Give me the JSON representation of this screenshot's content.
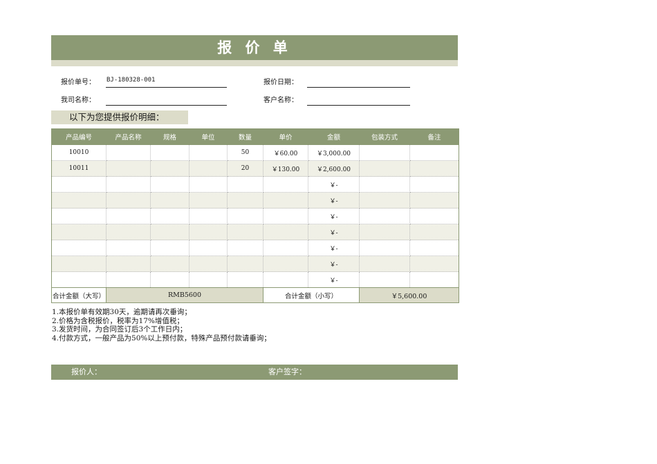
{
  "title": "报 价 单",
  "info": {
    "quote_no_label": "报价单号：",
    "quote_no_value": "BJ-180328-001",
    "quote_date_label": "报价日期：",
    "quote_date_value": "",
    "company_label": "我司名称：",
    "company_value": "",
    "customer_label": "客户名称：",
    "customer_value": ""
  },
  "detail_heading": "以下为您提供报价明细：",
  "table": {
    "headers": [
      "产品编号",
      "产品名称",
      "规格",
      "单位",
      "数量",
      "单价",
      "金额",
      "包装方式",
      "备注"
    ],
    "rows": [
      [
        "10010",
        "",
        "",
        "",
        "50",
        "￥60.00",
        "￥3,000.00",
        "",
        ""
      ],
      [
        "10011",
        "",
        "",
        "",
        "20",
        "￥130.00",
        "￥2,600.00",
        "",
        ""
      ],
      [
        "",
        "",
        "",
        "",
        "",
        "",
        "￥-",
        "",
        ""
      ],
      [
        "",
        "",
        "",
        "",
        "",
        "",
        "￥-",
        "",
        ""
      ],
      [
        "",
        "",
        "",
        "",
        "",
        "",
        "￥-",
        "",
        ""
      ],
      [
        "",
        "",
        "",
        "",
        "",
        "",
        "￥-",
        "",
        ""
      ],
      [
        "",
        "",
        "",
        "",
        "",
        "",
        "￥-",
        "",
        ""
      ],
      [
        "",
        "",
        "",
        "",
        "",
        "",
        "￥-",
        "",
        ""
      ],
      [
        "",
        "",
        "",
        "",
        "",
        "",
        "￥-",
        "",
        ""
      ]
    ],
    "total_upper_label": "合计金额（大写）",
    "total_upper_value": "RMB5600",
    "total_lower_label": "合计金额（小写）",
    "total_lower_value": "￥5,600.00"
  },
  "notes": [
    "1.本报价单有效期30天，逾期请再次垂询；",
    "2.价格为含税报价，税率为17%增值税；",
    "3.发货时间，为合同签订后3个工作日内；",
    "4.付款方式，一般产品为50%以上预付款，特殊产品预付款请垂询；"
  ],
  "signature": {
    "quoter_label": "报价人：",
    "customer_sign_label": "客户签字："
  },
  "colors": {
    "header_green": "#8c9a74",
    "light_band": "#dcdcc9",
    "row_alt": "#f0f0e6"
  }
}
